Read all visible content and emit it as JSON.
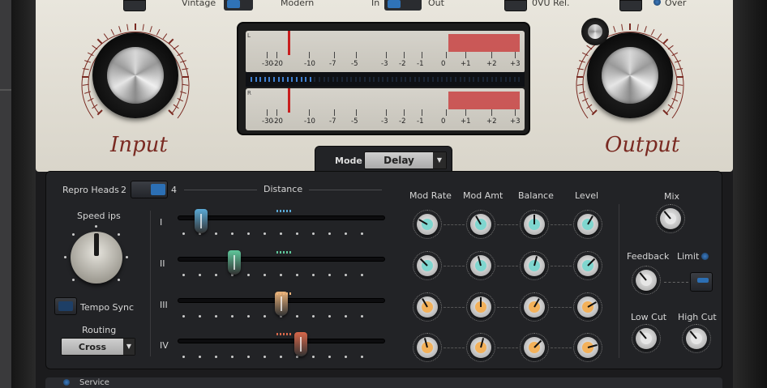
{
  "top_row": {
    "vintage_label": "Vintage",
    "modern_label": "Modern",
    "in_label": "In",
    "out_label": "Out",
    "ovu_label": "0VU Rel.",
    "over_label": "Over"
  },
  "input": {
    "label": "Input"
  },
  "output": {
    "label": "Output"
  },
  "meter": {
    "channel_left": "L",
    "channel_right": "R",
    "scale": [
      "-30",
      "-20",
      "-10",
      "-7",
      "-5",
      "-3",
      "-2",
      "-1",
      "0",
      "+1",
      "+2",
      "+3"
    ]
  },
  "mode": {
    "label": "Mode",
    "value": "Delay"
  },
  "repro_heads": {
    "label": "Repro Heads",
    "option_a": "2",
    "option_b": "4"
  },
  "distance": {
    "label": "Distance"
  },
  "speed": {
    "label": "Speed ips"
  },
  "tempo_sync": {
    "label": "Tempo Sync"
  },
  "routing": {
    "label": "Routing",
    "value": "Cross"
  },
  "columns": {
    "mod_rate": "Mod Rate",
    "mod_amt": "Mod Amt",
    "balance": "Balance",
    "level": "Level"
  },
  "heads": [
    {
      "roman": "I",
      "position": 0.03,
      "color": "#5aa9d6"
    },
    {
      "roman": "II",
      "position": 0.2,
      "color": "#5fc79b"
    },
    {
      "roman": "III",
      "position": 0.44,
      "color": "#e9b27a"
    },
    {
      "roman": "IV",
      "position": 0.54,
      "color": "#d8674a"
    }
  ],
  "right_section": {
    "mix": "Mix",
    "feedback": "Feedback",
    "limit": "Limit",
    "low_cut": "Low Cut",
    "high_cut": "High Cut"
  },
  "bottom": {
    "service_label": "Service"
  },
  "colors": {
    "accent_blue": "#2f73b8",
    "knob_teal": "#7fd6cf",
    "knob_orange": "#f3b15a",
    "meter_red": "#c94343"
  }
}
